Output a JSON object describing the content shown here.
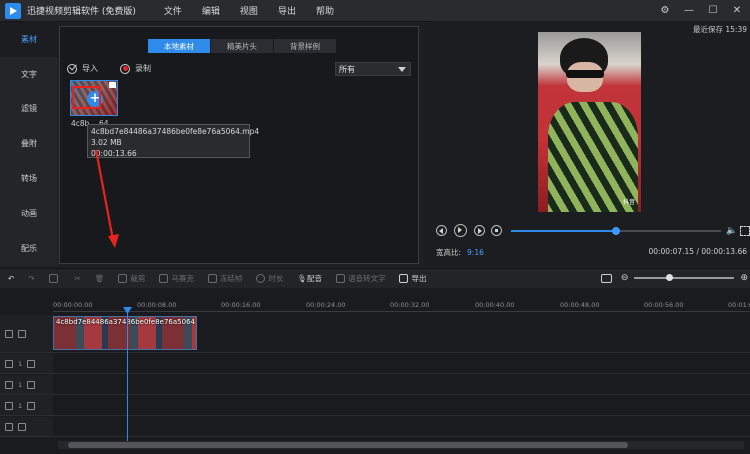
{
  "app": {
    "title": "迅捷视频剪辑软件 (免费版)",
    "menu": [
      "文件",
      "编辑",
      "视图",
      "导出",
      "帮助"
    ]
  },
  "sidebar": {
    "items": [
      "素材",
      "文字",
      "滤镜",
      "叠附",
      "转场",
      "动画",
      "配乐"
    ],
    "active_index": 0
  },
  "media": {
    "tabs": [
      "本地素材",
      "精美片头",
      "背景样例"
    ],
    "active_tab": 0,
    "import_label": "导入",
    "record_label": "录制",
    "filter_value": "所有",
    "thumbnail_label": "4c8b... 64",
    "tooltip": {
      "filename": "4c8bd7e84486a37486be0fe8e76a5064.mp4",
      "size": "3.02 MB",
      "duration": "00:00:13.66"
    }
  },
  "preview": {
    "autosave": "最近保存 15:39",
    "watermark": "抖音",
    "ratio_label": "宽高比:",
    "ratio_value": "9:16",
    "current_time": "00:00:07.15",
    "total_time": "00:00:13.66",
    "time_separator": "/",
    "progress_fraction": 0.5
  },
  "toolbar": {
    "items": [
      {
        "icon": "undo-icon",
        "label": "",
        "enabled": true
      },
      {
        "icon": "redo-icon",
        "label": "",
        "enabled": false
      },
      {
        "icon": "edit-icon",
        "label": "",
        "enabled": false
      },
      {
        "icon": "scissors-icon",
        "label": "",
        "enabled": false
      },
      {
        "icon": "delete-icon",
        "label": "",
        "enabled": false
      },
      {
        "icon": "crop-icon",
        "label": "裁剪",
        "enabled": false
      },
      {
        "icon": "mosaic-icon",
        "label": "马赛克",
        "enabled": false
      },
      {
        "icon": "freeze-icon",
        "label": "冻结帧",
        "enabled": false
      },
      {
        "icon": "duration-icon",
        "label": "时长",
        "enabled": false
      },
      {
        "icon": "microphone-icon",
        "label": "配音",
        "enabled": true
      },
      {
        "icon": "speech-to-text-icon",
        "label": "语音转文字",
        "enabled": false
      },
      {
        "icon": "export-icon",
        "label": "导出",
        "enabled": true
      }
    ],
    "zoom_fraction": 0.35
  },
  "timeline": {
    "ticks": [
      "00:00:00.00",
      "00:00:08.00",
      "00:00:16.00",
      "00:00:24.00",
      "00:00:32.00",
      "00:00:40.00",
      "00:00:48.00",
      "00:00:56.00",
      "00:01:0"
    ],
    "clip_title": "4c8bd7e84486a37486be0fe8e76a5064.mp4",
    "track_counts": [
      "1",
      "1",
      "1"
    ]
  },
  "colors": {
    "accent": "#2f8bea",
    "annotation_red": "#e8221e"
  }
}
